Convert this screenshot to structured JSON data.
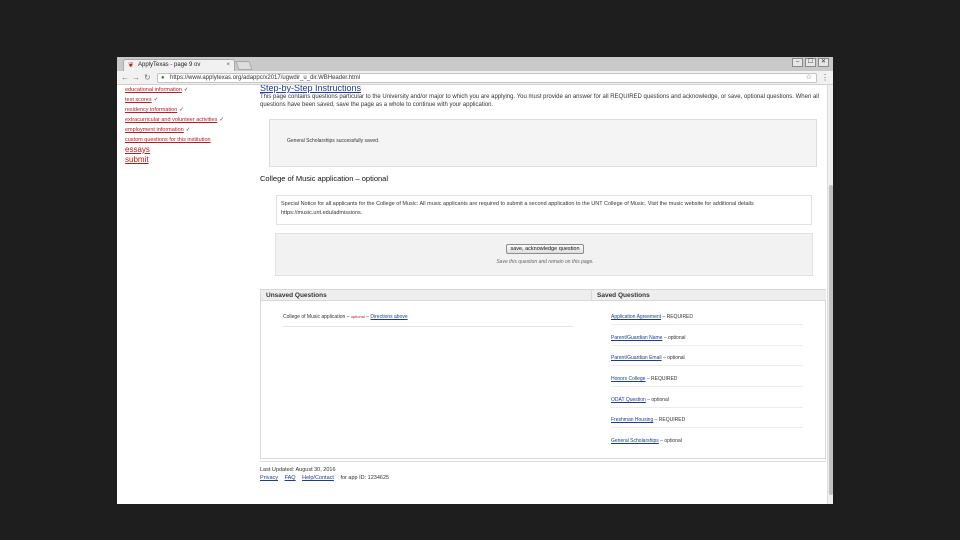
{
  "browser": {
    "tab_title": "ApplyTexas - page 9 ov",
    "tab_close": "×",
    "url": "https://www.applytexas.org/adappc/x2017/ugwdir_u_dir.WBHeader.html",
    "window_controls": [
      "–",
      "☐",
      "✕"
    ]
  },
  "sidebar": {
    "items": [
      {
        "label": "educational information",
        "check": "✓"
      },
      {
        "label": "test scores",
        "check": "✓"
      },
      {
        "label": "residency information",
        "check": "✓"
      },
      {
        "label": "extracurricular and volunteer activities",
        "check": "✓"
      },
      {
        "label": "employment information",
        "check": "✓"
      },
      {
        "label": "custom questions for this institution",
        "check": ""
      }
    ],
    "essays": "essays",
    "submit": "submit"
  },
  "main": {
    "step_title": "Step-by-Step Instructions",
    "intro": "This page contains questions particular to the University and/or major to which you are applying. You must provide an answer for all REQUIRED questions and acknowledge, or save, optional questions. When all questions have been saved, save the page as a whole to continue with your application.",
    "success_message": "General Scholarships successfully saved.",
    "section_title": "College of Music application – optional",
    "notice": "Special Notice for all applicants for the College of Music: All music applicants are required to submit a second application to the UNT College of Music. Visit the music website for additional details https://music.unt.edu/admissions.",
    "save_button": "save, acknowledge question",
    "save_hint": "Save this question and remain on this page."
  },
  "questions": {
    "unsaved_header": "Unsaved Questions",
    "saved_header": "Saved Questions",
    "unsaved": {
      "label": "College of Music application –",
      "status": "optional",
      "dash": "–",
      "link": "Directions above"
    },
    "saved": [
      {
        "label": "Application Agreement",
        "status": "– REQUIRED"
      },
      {
        "label": "Parent/Guardian Name",
        "status": "– optional"
      },
      {
        "label": "Parent/Guardian Email",
        "status": "– optional"
      },
      {
        "label": "Honors College",
        "status": "– REQUIRED"
      },
      {
        "label": "ODAT Question",
        "status": "– optional"
      },
      {
        "label": "Freshman Housing",
        "status": "– REQUIRED"
      },
      {
        "label": "General Scholarships",
        "status": "– optional"
      }
    ]
  },
  "footer": {
    "last_updated": "Last Updated: August 30, 2016",
    "links": [
      "Privacy",
      "FAQ",
      "Help/Contact"
    ],
    "app_id": "for app ID: 1234625"
  },
  "colors": {
    "link": "#1a3d8f",
    "sidebar_link": "#b71c1c",
    "backdrop": "#1e1e1e"
  },
  "icons": [
    "back-icon",
    "forward-icon",
    "reload-icon",
    "lock-icon",
    "star-icon",
    "menu-icon",
    "favicon-icon"
  ]
}
